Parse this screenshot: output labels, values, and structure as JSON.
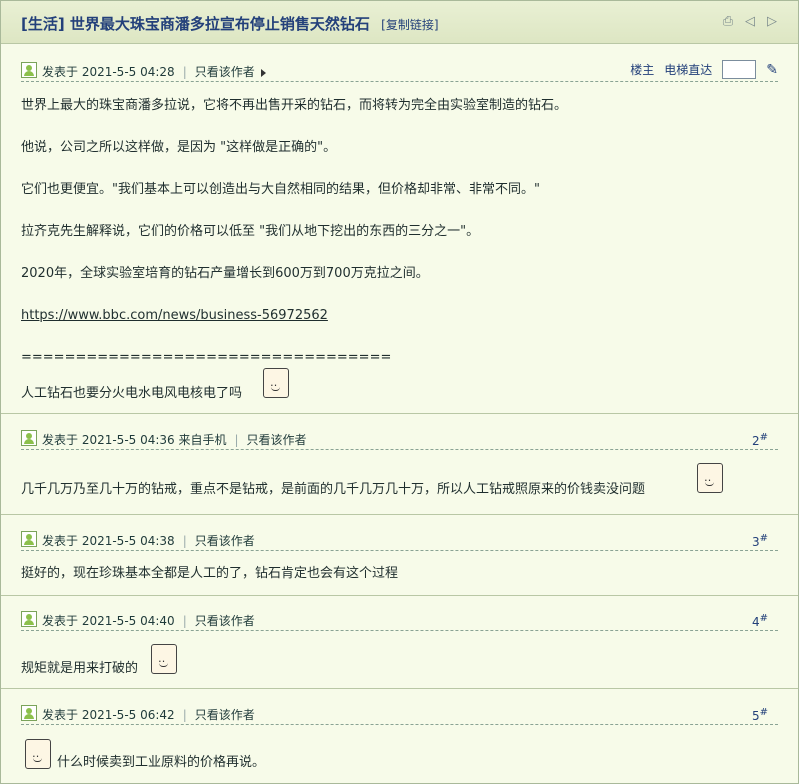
{
  "thread": {
    "title": "[生活] 世界最大珠宝商潘多拉宣布停止销售天然钻石",
    "copy_link": "[复制链接]"
  },
  "icons": {
    "print": "print-icon",
    "prev": "prev-thread-icon",
    "next": "next-thread-icon"
  },
  "floor_tools": {
    "op_label": "楼主",
    "jump_label": "电梯直达",
    "jump_value": ""
  },
  "posts": [
    {
      "posted": "发表于 2021-5-5 04:28",
      "only_author": "只看该作者",
      "floor": "",
      "lines": [
        "世界上最大的珠宝商潘多拉说，它将不再出售开采的钻石，而将转为完全由实验室制造的钻石。",
        "他说，公司之所以这样做，是因为 \"这样做是正确的\"。",
        "它们也更便宜。\"我们基本上可以创造出与大自然相同的结果，但价格却非常、非常不同。\"",
        "拉齐克先生解释说，它们的价格可以低至 \"我们从地下挖出的东西的三分之一\"。",
        "2020年，全球实验室培育的钻石产量增长到600万到700万克拉之间。",
        "https://www.bbc.com/news/business-56972562",
        "==================================",
        "人工钻石也要分火电水电风电核电了吗"
      ]
    },
    {
      "posted": "发表于 2021-5-5 04:36 来自手机",
      "only_author": "只看该作者",
      "floor": "2",
      "lines": [
        "几千几万乃至几十万的钻戒，重点不是钻戒，是前面的几千几万几十万，所以人工钻戒照原来的价钱卖没问题"
      ]
    },
    {
      "posted": "发表于 2021-5-5 04:38",
      "only_author": "只看该作者",
      "floor": "3",
      "lines": [
        "挺好的，现在珍珠基本全都是人工的了，钻石肯定也会有这个过程"
      ]
    },
    {
      "posted": "发表于 2021-5-5 04:40",
      "only_author": "只看该作者",
      "floor": "4",
      "lines": [
        "规矩就是用来打破的"
      ]
    },
    {
      "posted": "发表于 2021-5-5 06:42",
      "only_author": "只看该作者",
      "floor": "5",
      "lines": [
        "什么时候卖到工业原料的价格再说。"
      ]
    }
  ],
  "floor_mark": "#",
  "colors": {
    "background": "#f7fbe9",
    "title": "#23407a",
    "border": "#b9c7a5"
  }
}
